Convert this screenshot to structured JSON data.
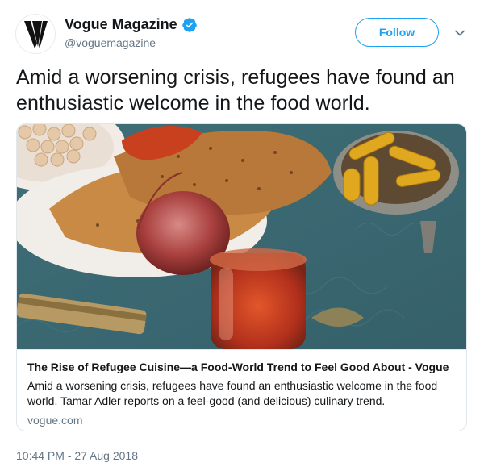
{
  "author": {
    "display_name": "Vogue Magazine",
    "handle": "@voguemagazine",
    "verified": true,
    "avatar_icon": "vogue-v-logo-icon"
  },
  "actions": {
    "follow_label": "Follow",
    "more_icon": "chevron-down-icon"
  },
  "tweet": {
    "text": "Amid a worsening crisis, refugees have found an enthusiastic welcome in the food world.",
    "timestamp": "10:44 PM - 27 Aug 2018"
  },
  "card": {
    "image_alt_icon": "food-photo-image",
    "title": "The Rise of Refugee Cuisine—a Food-World Trend to Feel Good About - Vogue",
    "description": "Amid a worsening crisis, refugees have found an enthusiastic welcome in the food world. Tamar Adler reports on a feel-good (and delicious) culinary trend.",
    "domain": "vogue.com"
  },
  "colors": {
    "accent": "#1da1f2",
    "text": "#14171a",
    "muted": "#657786",
    "border": "#e1e8ed"
  }
}
